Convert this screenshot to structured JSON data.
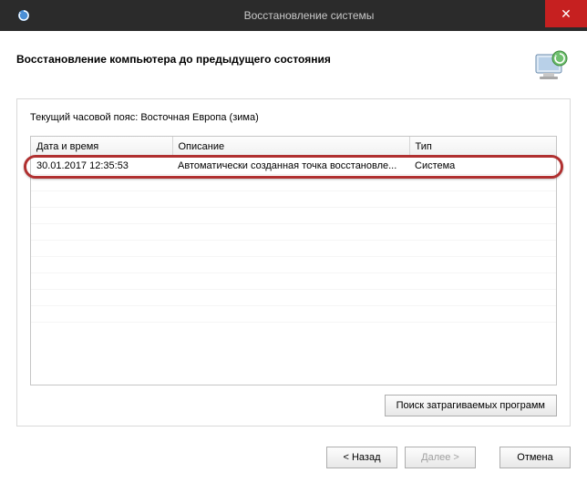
{
  "titlebar": {
    "title": "Восстановление системы",
    "close": "✕"
  },
  "header": {
    "title": "Восстановление компьютера до предыдущего состояния"
  },
  "panel": {
    "timezone_label": "Текущий часовой пояс: Восточная Европа (зима)"
  },
  "table": {
    "columns": {
      "datetime": "Дата и время",
      "description": "Описание",
      "type": "Тип"
    },
    "rows": [
      {
        "datetime": "30.01.2017 12:35:53",
        "description": "Автоматически созданная точка восстановле...",
        "type": "Система"
      }
    ]
  },
  "buttons": {
    "scan_affected": "Поиск затрагиваемых программ",
    "back": "< Назад",
    "next": "Далее >",
    "cancel": "Отмена"
  }
}
